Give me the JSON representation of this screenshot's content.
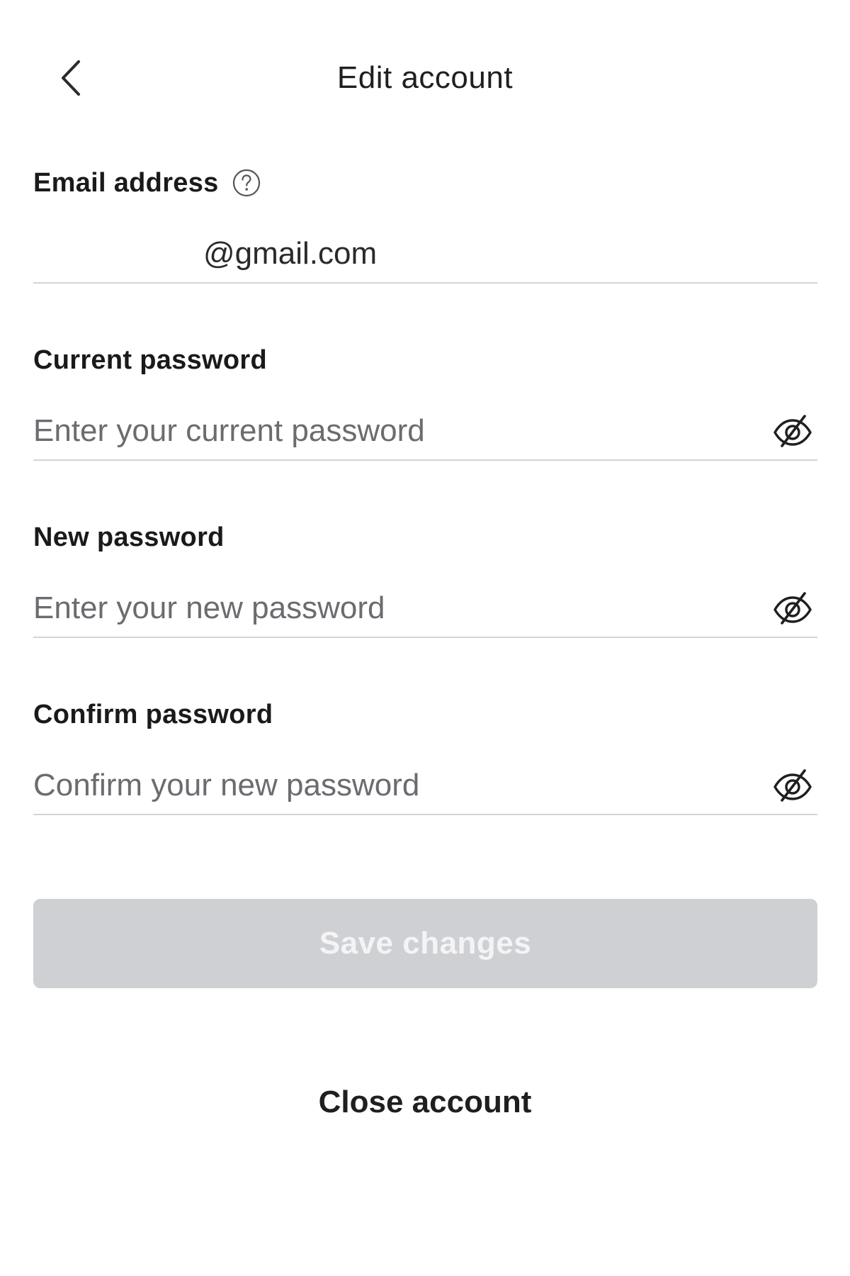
{
  "header": {
    "title": "Edit account",
    "back_icon": "chevron-left-icon"
  },
  "email": {
    "label": "Email address",
    "help_icon": "question-circle-icon",
    "value": "@gmail.com"
  },
  "current_password": {
    "label": "Current password",
    "placeholder": "Enter your current password",
    "toggle_icon": "eye-slash-icon"
  },
  "new_password": {
    "label": "New password",
    "placeholder": "Enter your new password",
    "toggle_icon": "eye-slash-icon"
  },
  "confirm_password": {
    "label": "Confirm password",
    "placeholder": "Confirm your new password",
    "toggle_icon": "eye-slash-icon"
  },
  "actions": {
    "save_label": "Save changes",
    "save_state": "disabled",
    "close_account_label": "Close account"
  },
  "colors": {
    "text": "#1f1f1f",
    "placeholder": "#6b6b70",
    "divider": "#d4d4d8",
    "button_disabled_bg": "#cfd0d4",
    "button_disabled_text": "#f4f4f6"
  }
}
